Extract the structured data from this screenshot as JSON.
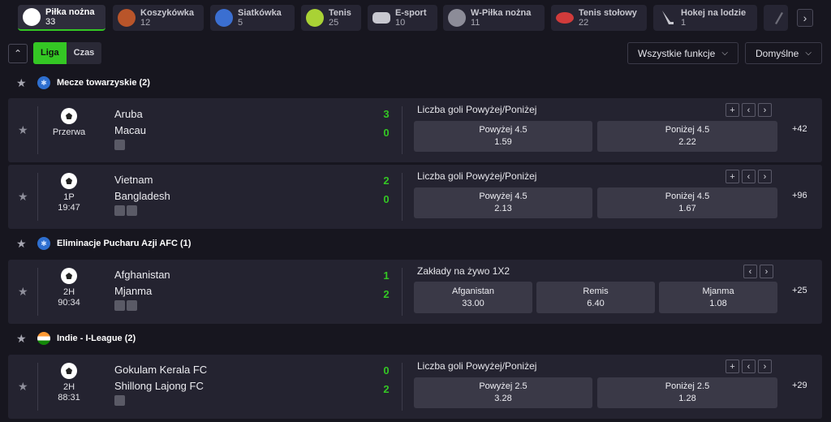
{
  "sports": [
    {
      "name": "Piłka nożna",
      "count": "33",
      "icon": "soccer-ball-icon",
      "color": "#ffffff"
    },
    {
      "name": "Koszykówka",
      "count": "12",
      "icon": "basketball-icon",
      "color": "#b9552a"
    },
    {
      "name": "Siatkówka",
      "count": "5",
      "icon": "volleyball-icon",
      "color": "#3b6fd1"
    },
    {
      "name": "Tenis",
      "count": "25",
      "icon": "tennis-ball-icon",
      "color": "#a9d235"
    },
    {
      "name": "E-sport",
      "count": "10",
      "icon": "gamepad-icon",
      "color": "#c8c8d0"
    },
    {
      "name": "W-Piłka nożna",
      "count": "11",
      "icon": "virtual-soccer-icon",
      "color": "#8c8c98"
    },
    {
      "name": "Tenis stołowy",
      "count": "22",
      "icon": "table-tennis-icon",
      "color": "#d13b3b"
    },
    {
      "name": "Hokej na lodzie",
      "count": "1",
      "icon": "hockey-stick-icon",
      "color": "#c7c7cf"
    }
  ],
  "next_icon": "›",
  "collapse_icon": "⌃",
  "view_tabs": {
    "liga": "Liga",
    "czas": "Czas"
  },
  "dropdowns": {
    "features": "Wszystkie funkcje",
    "sort": "Domyślne",
    "chevron": "⌵"
  },
  "leagues": [
    {
      "name": "Mecze towarzyskie (2)",
      "flag": "world-flag-icon"
    },
    {
      "name": "Eliminacje Pucharu Azji AFC (1)",
      "flag": "world-flag-icon"
    },
    {
      "name": "Indie - I-League (2)",
      "flag": "india-flag-icon"
    }
  ],
  "star_icon": "★",
  "matches": [
    {
      "status_line1": "Przerwa",
      "status_line2": "",
      "home": "Aruba",
      "away": "Macau",
      "score_home": "3",
      "score_away": "0",
      "market": "Liczba goli Powyżej/Poniżej",
      "odds": [
        {
          "label": "Powyżej  4.5",
          "value": "1.59"
        },
        {
          "label": "Poniżej  4.5",
          "value": "2.22"
        }
      ],
      "more": "+42"
    },
    {
      "status_line1": "1P",
      "status_line2": "19:47",
      "home": "Vietnam",
      "away": "Bangladesh",
      "score_home": "2",
      "score_away": "0",
      "market": "Liczba goli Powyżej/Poniżej",
      "odds": [
        {
          "label": "Powyżej  4.5",
          "value": "2.13"
        },
        {
          "label": "Poniżej  4.5",
          "value": "1.67"
        }
      ],
      "more": "+96"
    },
    {
      "status_line1": "2H",
      "status_line2": "90:34",
      "home": "Afghanistan",
      "away": "Mjanma",
      "score_home": "1",
      "score_away": "2",
      "market": "Zakłady na żywo 1X2",
      "odds": [
        {
          "label": "Afganistan",
          "value": "33.00"
        },
        {
          "label": "Remis",
          "value": "6.40"
        },
        {
          "label": "Mjanma",
          "value": "1.08"
        }
      ],
      "more": "+25"
    },
    {
      "status_line1": "2H",
      "status_line2": "88:31",
      "home": "Gokulam Kerala FC",
      "away": "Shillong Lajong FC",
      "score_home": "0",
      "score_away": "2",
      "market": "Liczba goli Powyżej/Poniżej",
      "odds": [
        {
          "label": "Powyżej  2.5",
          "value": "3.28"
        },
        {
          "label": "Poniżej  2.5",
          "value": "1.28"
        }
      ],
      "more": "+29"
    }
  ],
  "ctrl_icons": {
    "plus": "+",
    "prev": "‹",
    "next": "›"
  }
}
